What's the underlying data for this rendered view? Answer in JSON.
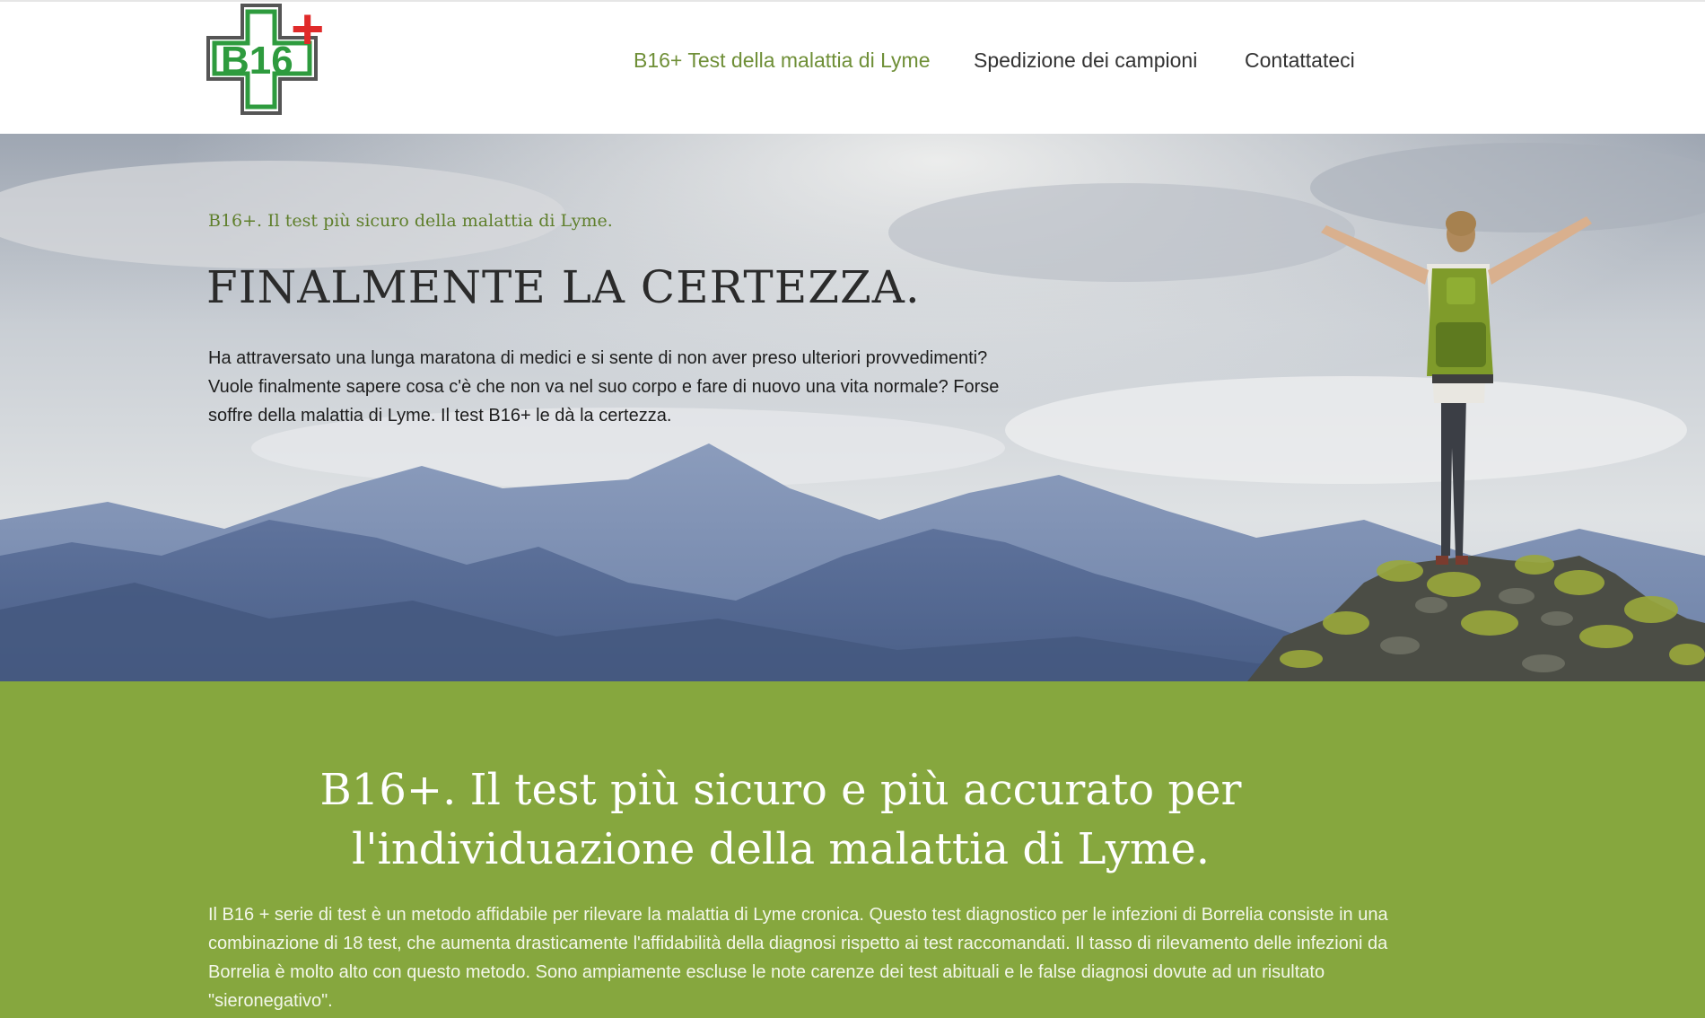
{
  "logo": {
    "text": "B16",
    "plus_symbol": "+",
    "colors": {
      "green": "#2e9b3e",
      "red": "#e02a2a",
      "frame": "#555555"
    }
  },
  "nav": {
    "items": [
      {
        "label": "B16+ Test della malattia di Lyme",
        "active": true
      },
      {
        "label": "Spedizione dei campioni",
        "active": false
      },
      {
        "label": "Contattateci",
        "active": false
      }
    ],
    "active_color": "#6f8f37",
    "text_color": "#333333"
  },
  "hero": {
    "kicker": "B16+. Il test più sicuro della malattia di Lyme.",
    "title": "FINALMENTE LA CERTEZZA.",
    "text": "Ha attraversato una lunga maratona di medici e si sente di non aver preso ulteriori provvedimenti? Vuole finalmente sapere cosa c'è che non va nel suo corpo e fare di nuovo una vita normale? Forse soffre della malattia di Lyme. Il test B16+ le dà la certezza.",
    "image_icon": "hiker-on-mountain-summit"
  },
  "section": {
    "title_line1": "B16+. Il test più sicuro e più accurato per",
    "title_line2": "l'individuazione della malattia di Lyme.",
    "text": "Il B16 + serie di test è un metodo affidabile per rilevare la malattia di Lyme cronica. Questo test diagnostico per le infezioni di Borrelia consiste in una combinazione di 18 test, che aumenta drasticamente l'affidabilità della diagnosi rispetto ai test raccomandati. Il tasso di rilevamento delle infezioni da Borrelia è molto alto con questo metodo. Sono ampiamente escluse le note carenze dei test abituali e le false diagnosi dovute ad un risultato \"sieronegativo\".",
    "background_color": "#86a73e"
  }
}
